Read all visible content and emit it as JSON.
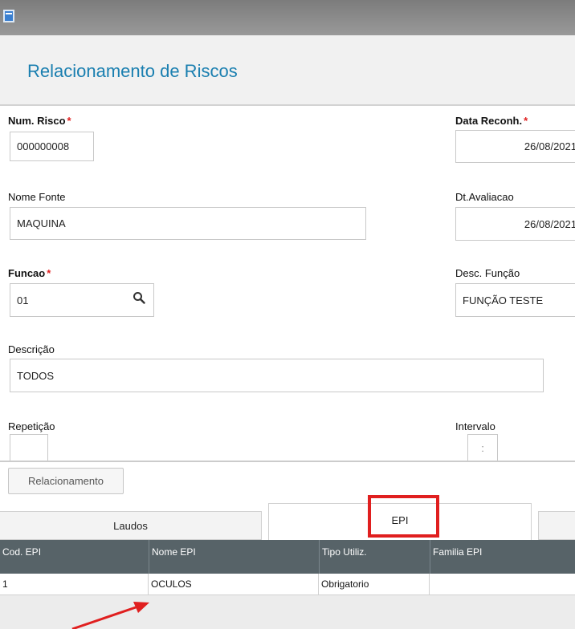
{
  "page": {
    "title": "Relacionamento de Riscos"
  },
  "form": {
    "num_risco": {
      "label": "Num. Risco",
      "value": "000000008"
    },
    "data_reconh": {
      "label": "Data Reconh.",
      "value": "26/08/2021"
    },
    "nome_fonte": {
      "label": "Nome Fonte",
      "value": "MAQUINA"
    },
    "dt_avaliacao": {
      "label": "Dt.Avaliacao",
      "value": "26/08/2021"
    },
    "funcao": {
      "label": "Funcao",
      "value": "01"
    },
    "desc_funcao": {
      "label": "Desc. Função",
      "value": "FUNÇÃO TESTE"
    },
    "descricao": {
      "label": "Descrição",
      "value": "TODOS"
    },
    "repeticao": {
      "label": "Repetição",
      "value": ""
    },
    "intervalo": {
      "label": "Intervalo",
      "value": ":"
    },
    "required_mark": "*"
  },
  "actions": {
    "relacionamento_label": "Relacionamento"
  },
  "tabs": [
    {
      "label": "Laudos"
    },
    {
      "label": "EPI"
    }
  ],
  "grid": {
    "columns": [
      "Cod. EPI",
      "Nome EPI",
      "Tipo Utiliz.",
      "Familia EPI"
    ],
    "rows": [
      [
        "1",
        "OCULOS",
        "Obrigatorio",
        ""
      ]
    ]
  },
  "colors": {
    "accent": "#1a7fb0",
    "highlight": "#e01f1f",
    "grid_header": "#576368"
  }
}
